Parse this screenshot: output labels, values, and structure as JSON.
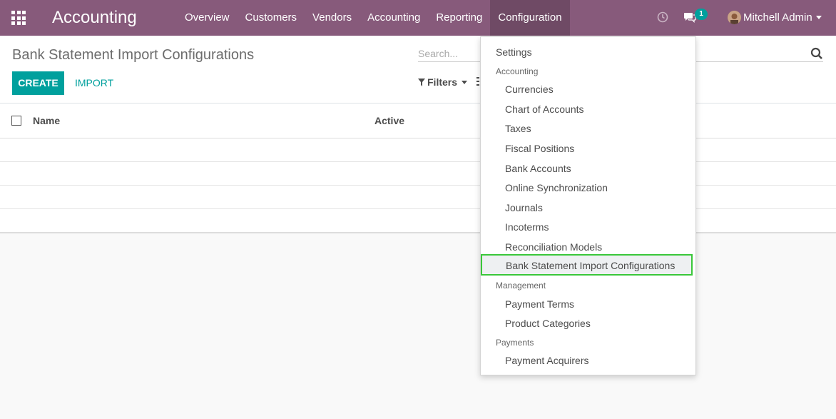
{
  "navbar": {
    "brand": "Accounting",
    "menu": [
      "Overview",
      "Customers",
      "Vendors",
      "Accounting",
      "Reporting",
      "Configuration"
    ],
    "active_menu": "Configuration",
    "chat_badge": "1",
    "user_name": "Mitchell Admin",
    "color": "#875a7b"
  },
  "control_panel": {
    "title": "Bank Statement Import Configurations",
    "create_label": "CREATE",
    "import_label": "IMPORT",
    "search_placeholder": "Search...",
    "filters_label": "Filters",
    "accent_color": "#00a09d"
  },
  "list": {
    "columns": [
      "Name",
      "Active"
    ]
  },
  "dropdown": {
    "settings": "Settings",
    "accounting_header": "Accounting",
    "accounting_items": [
      "Currencies",
      "Chart of Accounts",
      "Taxes",
      "Fiscal Positions",
      "Bank Accounts",
      "Online Synchronization",
      "Journals",
      "Incoterms",
      "Reconciliation Models",
      "Bank Statement Import Configurations"
    ],
    "management_header": "Management",
    "management_items": [
      "Payment Terms",
      "Product Categories"
    ],
    "payments_header": "Payments",
    "payments_items": [
      "Payment Acquirers"
    ],
    "highlight_color": "#3ac73a"
  }
}
